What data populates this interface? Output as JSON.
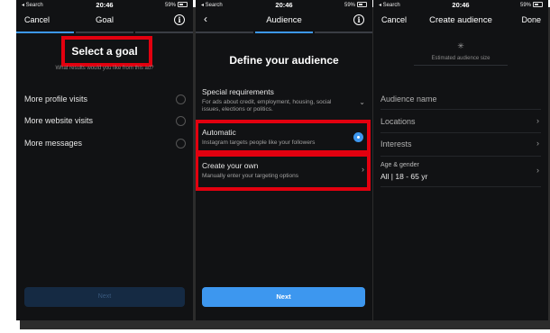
{
  "status_bar": {
    "carrier": "◂ Search",
    "time": "20:46",
    "right": "59%"
  },
  "screen1": {
    "nav_left": "Cancel",
    "nav_title": "Goal",
    "heading": "Select a goal",
    "subheading": "What results would you like from this ad?",
    "options": [
      "More profile visits",
      "More website visits",
      "More messages"
    ],
    "next_label": "Next"
  },
  "screen2": {
    "nav_title": "Audience",
    "heading": "Define your audience",
    "special": {
      "title": "Special requirements",
      "desc": "For ads about credit, employment, housing, social issues, elections or politics."
    },
    "automatic": {
      "title": "Automatic",
      "desc": "Instagram targets people like your followers"
    },
    "create": {
      "title": "Create your own",
      "desc": "Manually enter your targeting options"
    },
    "next_label": "Next"
  },
  "screen3": {
    "nav_left": "Cancel",
    "nav_title": "Create audience",
    "nav_right": "Done",
    "estimated": "Estimated audience size",
    "audience_name": "Audience name",
    "locations": "Locations",
    "interests": "Interests",
    "age_gender_label": "Age & gender",
    "age_gender_value": "All | 18 - 65 yr"
  },
  "colors": {
    "accent": "#3d97ef",
    "highlight": "#e3000f",
    "background": "#111214"
  }
}
